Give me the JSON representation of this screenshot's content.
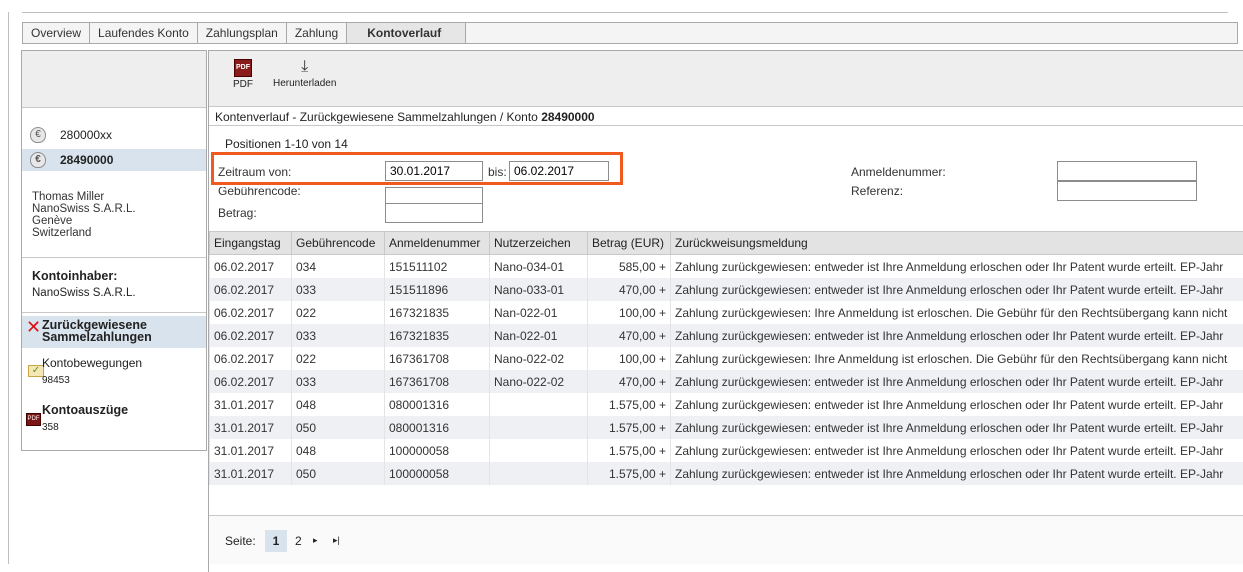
{
  "tabs": [
    "Overview",
    "Laufendes Konto",
    "Zahlungsplan",
    "Zahlung",
    "Kontoverlauf"
  ],
  "sidebar": {
    "accounts": [
      "280000xx",
      "28490000"
    ],
    "address": [
      "Thomas Miller",
      "NanoSwiss S.A.R.L.",
      "Genève",
      "Switzerland"
    ],
    "owner_title": "Kontoinhaber:",
    "owner_name": "NanoSwiss S.A.R.L.",
    "nav": [
      {
        "label": "Zurückgewiesene Sammelzahlungen"
      },
      {
        "label": "Kontobewegungen",
        "count": "98453"
      },
      {
        "label": "Kontoauszüge",
        "count": "358"
      }
    ]
  },
  "toolbar": {
    "pdf": "PDF",
    "download": "Herunterladen"
  },
  "breadcrumb": {
    "prefix": "Kontenverlauf - Zurückgewiesene Sammelzahlungen / Konto ",
    "account": "28490000"
  },
  "positions": "Positionen 1-10 von 14",
  "filters": {
    "zeitraum_von_label": "Zeitraum von:",
    "zeitraum_von": "30.01.2017",
    "bis_label": "bis:",
    "bis": "06.02.2017",
    "gebuehrencode_label": "Gebührencode:",
    "betrag_label": "Betrag:",
    "anmeldenummer_label": "Anmeldenummer:",
    "referenz_label": "Referenz:"
  },
  "table": {
    "headers": [
      "Eingangstag",
      "Gebührencode",
      "Anmeldenummer",
      "Nutzerzeichen",
      "Betrag (EUR)",
      "Zurückweisungsmeldung"
    ],
    "rows": [
      [
        "06.02.2017",
        "034",
        "151511102",
        "Nano-034-01",
        "585,00 +",
        "Zahlung zurückgewiesen: entweder ist Ihre Anmeldung erloschen oder Ihr Patent wurde erteilt. EP-Jahr"
      ],
      [
        "06.02.2017",
        "033",
        "151511896",
        "Nano-033-01",
        "470,00 +",
        "Zahlung zurückgewiesen: entweder ist Ihre Anmeldung erloschen oder Ihr Patent wurde erteilt. EP-Jahr"
      ],
      [
        "06.02.2017",
        "022",
        "167321835",
        "Nan-022-01",
        "100,00 +",
        "Zahlung zurückgewiesen: Ihre Anmeldung ist erloschen. Die Gebühr für den Rechtsübergang kann nicht"
      ],
      [
        "06.02.2017",
        "033",
        "167321835",
        "Nan-022-01",
        "470,00 +",
        "Zahlung zurückgewiesen: entweder ist Ihre Anmeldung erloschen oder Ihr Patent wurde erteilt. EP-Jahr"
      ],
      [
        "06.02.2017",
        "022",
        "167361708",
        "Nano-022-02",
        "100,00 +",
        "Zahlung zurückgewiesen: Ihre Anmeldung ist erloschen. Die Gebühr für den Rechtsübergang kann nicht"
      ],
      [
        "06.02.2017",
        "033",
        "167361708",
        "Nano-022-02",
        "470,00 +",
        "Zahlung zurückgewiesen: entweder ist Ihre Anmeldung erloschen oder Ihr Patent wurde erteilt. EP-Jahr"
      ],
      [
        "31.01.2017",
        "048",
        "080001316",
        "",
        "1.575,00 +",
        "Zahlung zurückgewiesen: entweder ist Ihre Anmeldung erloschen oder Ihr Patent wurde erteilt. EP-Jahr"
      ],
      [
        "31.01.2017",
        "050",
        "080001316",
        "",
        "1.575,00 +",
        "Zahlung zurückgewiesen: entweder ist Ihre Anmeldung erloschen oder Ihr Patent wurde erteilt. EP-Jahr"
      ],
      [
        "31.01.2017",
        "048",
        "100000058",
        "",
        "1.575,00 +",
        "Zahlung zurückgewiesen: entweder ist Ihre Anmeldung erloschen oder Ihr Patent wurde erteilt. EP-Jahr"
      ],
      [
        "31.01.2017",
        "050",
        "100000058",
        "",
        "1.575,00 +",
        "Zahlung zurückgewiesen: entweder ist Ihre Anmeldung erloschen oder Ihr Patent wurde erteilt. EP-Jahr"
      ]
    ]
  },
  "pager": {
    "label": "Seite:",
    "current": "1",
    "next_page": "2",
    "next_icon": "▸",
    "last_icon": "▸|"
  },
  "colors": {
    "highlight": "#f05a1e",
    "selected": "#d9e3ee"
  }
}
